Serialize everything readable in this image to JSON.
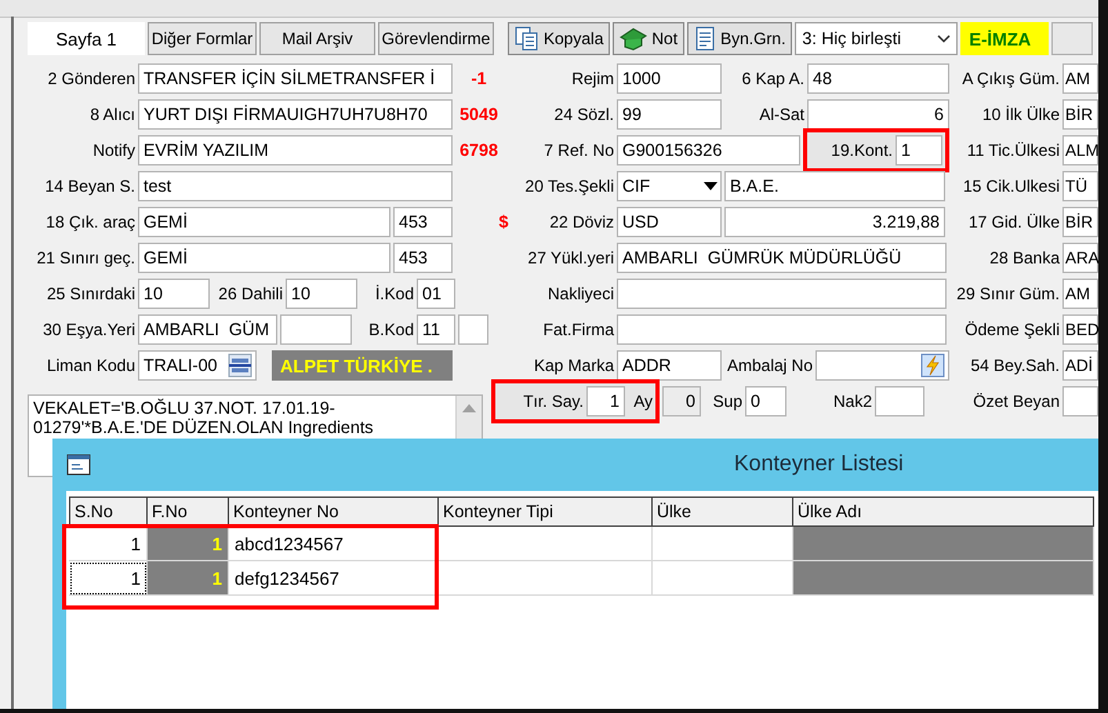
{
  "tabs": [
    {
      "label": "Sayfa 1",
      "selected": true
    },
    {
      "label": "Diğer Formlar",
      "selected": false
    },
    {
      "label": "Mail Arşiv",
      "selected": false
    },
    {
      "label": "Görevlendirme",
      "selected": false
    }
  ],
  "toolbar": {
    "buttons": [
      {
        "label": "Kopyala",
        "kind": "copy"
      },
      {
        "label": "Not",
        "kind": "note"
      },
      {
        "label": "Byn.Grn.",
        "kind": "view"
      }
    ],
    "merge_select": {
      "value": "3: Hiç birleşti"
    },
    "esign_badge": "E-İMZA"
  },
  "left_rows": [
    [
      {
        "kind": "label",
        "text": "2 Gönderen"
      },
      {
        "kind": "field",
        "value": "TRANSFER İÇİN SİLMETRANSFER İ"
      },
      {
        "kind": "code",
        "text": "-1"
      }
    ],
    [
      {
        "kind": "label",
        "text": "8 Alıcı"
      },
      {
        "kind": "field",
        "value": "YURT DIŞI FİRMAUIGH7UH7U8H70"
      },
      {
        "kind": "code",
        "text": "5049"
      }
    ],
    [
      {
        "kind": "label",
        "text": "Notify"
      },
      {
        "kind": "field",
        "value": "EVRİM YAZILIM"
      },
      {
        "kind": "code",
        "text": "6798"
      }
    ],
    [
      {
        "kind": "label",
        "text": "14 Beyan S."
      },
      {
        "kind": "field",
        "value": "test"
      }
    ],
    [
      {
        "kind": "label",
        "text": "18 Çık. araç"
      },
      {
        "kind": "field",
        "value": "GEMİ"
      },
      {
        "kind": "field",
        "value": "453"
      }
    ],
    [
      {
        "kind": "label",
        "text": "21 Sınırı geç."
      },
      {
        "kind": "field",
        "value": "GEMİ"
      },
      {
        "kind": "field",
        "value": "453"
      }
    ],
    [
      {
        "kind": "label",
        "text": "25 Sınırdaki"
      },
      {
        "kind": "field",
        "value": "10"
      },
      {
        "kind": "label",
        "text": "26 Dahili"
      },
      {
        "kind": "field",
        "value": "10"
      },
      {
        "kind": "label",
        "text": "İ.Kod"
      },
      {
        "kind": "field",
        "value": "01"
      }
    ],
    [
      {
        "kind": "label",
        "text": "30 Eşya.Yeri"
      },
      {
        "kind": "field",
        "value": "AMBARLI  GÜM"
      },
      {
        "kind": "field"
      },
      {
        "kind": "label",
        "text": "B.Kod"
      },
      {
        "kind": "field",
        "value": "11"
      },
      {
        "kind": "field"
      }
    ],
    [
      {
        "kind": "label",
        "text": "Liman Kodu"
      },
      {
        "kind": "lookup-field",
        "value": "TRALI-00"
      },
      {
        "kind": "badge",
        "text": "ALPET TÜRKİYE ."
      }
    ]
  ],
  "memo": {
    "lines": [
      "VEKALET='B.OĞLU 37.NOT. 17.01.19-",
      "01279'*B.A.E.'DE DÜZEN.OLAN  Ingredients"
    ]
  },
  "middle_rows": [
    [
      {
        "kind": "label",
        "text": "Rejim"
      },
      {
        "kind": "field",
        "value": "1000"
      },
      {
        "kind": "label",
        "text": "6 Kap A."
      },
      {
        "kind": "field",
        "value": "48"
      }
    ],
    [
      {
        "kind": "label",
        "text": "24 Sözl."
      },
      {
        "kind": "field",
        "value": "99"
      },
      {
        "kind": "label",
        "text": "Al-Sat"
      },
      {
        "kind": "numeric-field",
        "value": "6"
      }
    ],
    [
      {
        "kind": "label",
        "text": "7 Ref. No"
      },
      {
        "kind": "field",
        "value": "G900156326"
      },
      {
        "kind": "group",
        "items": [
          {
            "kind": "label",
            "text": "19.Kont."
          },
          {
            "kind": "field",
            "value": "1"
          }
        ]
      }
    ],
    [
      {
        "kind": "label",
        "text": "20 Tes.Şekli"
      },
      {
        "kind": "combo",
        "value": "CIF"
      },
      {
        "kind": "field",
        "value": "B.A.E."
      }
    ],
    [
      {
        "kind": "code",
        "text": "$"
      },
      {
        "kind": "label",
        "text": "22 Döviz"
      },
      {
        "kind": "field",
        "value": "USD"
      },
      {
        "kind": "numeric-field",
        "value": "3.219,88"
      }
    ],
    [
      {
        "kind": "label",
        "text": "27 Yükl.yeri"
      },
      {
        "kind": "field",
        "value": "AMBARLI  GÜMRÜK MÜDÜRLÜĞÜ"
      }
    ],
    [
      {
        "kind": "label",
        "text": "Nakliyeci"
      },
      {
        "kind": "field"
      }
    ],
    [
      {
        "kind": "label",
        "text": "Fat.Firma"
      },
      {
        "kind": "field"
      }
    ],
    [
      {
        "kind": "label",
        "text": "Kap Marka"
      },
      {
        "kind": "field",
        "value": "ADDR"
      },
      {
        "kind": "label",
        "text": "Ambalaj No"
      },
      {
        "kind": "action-field"
      }
    ],
    [
      {
        "kind": "group",
        "items": [
          {
            "kind": "label",
            "text": "Tır. Say."
          },
          {
            "kind": "numeric-field",
            "value": "1"
          },
          {
            "kind": "label",
            "text": "Ay"
          }
        ]
      },
      {
        "kind": "readonly-field",
        "value": "0"
      },
      {
        "kind": "label",
        "text": "Sup"
      },
      {
        "kind": "field",
        "value": "0"
      },
      {
        "kind": "label",
        "text": "Nak2"
      },
      {
        "kind": "field"
      }
    ]
  ],
  "right_rows": [
    {
      "label": "A Çıkış Güm.",
      "value": "AM"
    },
    {
      "label": "10 İlk Ülke",
      "value": "BİR"
    },
    {
      "label": "11 Tic.Ülkesi",
      "value": "ALM"
    },
    {
      "label": "15 Cik.Ulkesi",
      "value": "TÜ"
    },
    {
      "label": "17 Gid. Ülke",
      "value": "BİR"
    },
    {
      "label": "28 Banka",
      "value": "ARA"
    },
    {
      "label": "29 Sınır Güm.",
      "value": "AM"
    },
    {
      "label": "Ödeme Şekli",
      "value": "BED"
    },
    {
      "label": "54 Bey.Sah.",
      "value": "ADİ"
    },
    {
      "label": "Özet Beyan"
    }
  ],
  "dialog": {
    "title": "Konteyner Listesi",
    "highlight": true,
    "columns": [
      "S.No",
      "F.No",
      "Konteyner No",
      "Konteyner Tipi",
      "Ülke",
      "Ülke Adı"
    ],
    "rows": [
      {
        "s_no": "1",
        "f_no": "1",
        "konteyner_no": "abcd1234567",
        "focused": false
      },
      {
        "s_no": "1",
        "f_no": "1",
        "konteyner_no": "defg1234567",
        "focused": true
      }
    ]
  }
}
